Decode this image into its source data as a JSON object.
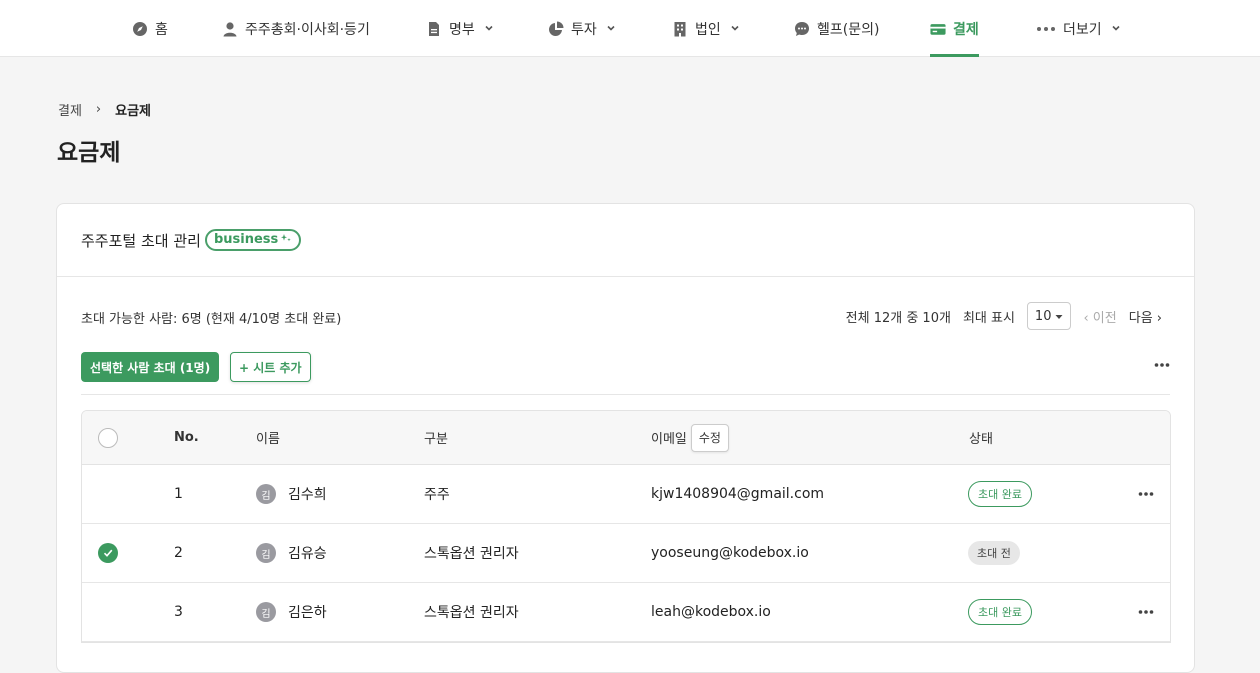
{
  "nav": {
    "items": [
      {
        "label": "홈",
        "icon": "compass-icon",
        "has_dropdown": false
      },
      {
        "label": "주주총회·이사회·등기",
        "icon": "person-icon",
        "has_dropdown": false
      },
      {
        "label": "명부",
        "icon": "document-icon",
        "has_dropdown": true
      },
      {
        "label": "투자",
        "icon": "pie-chart-icon",
        "has_dropdown": true
      },
      {
        "label": "법인",
        "icon": "building-icon",
        "has_dropdown": true
      },
      {
        "label": "헬프(문의)",
        "icon": "chat-bubble-icon",
        "has_dropdown": false
      },
      {
        "label": "결제",
        "icon": "credit-card-icon",
        "has_dropdown": false,
        "active": true
      },
      {
        "label": "더보기",
        "icon": "more-dots-icon",
        "has_dropdown": true
      }
    ]
  },
  "breadcrumb": {
    "parent": "결제",
    "separator": "›",
    "current": "요금제"
  },
  "page_title": "요금제",
  "card": {
    "title": "주주포털 초대 관리",
    "badge": "business",
    "info_text": "초대 가능한 사람: 6명 (현재 4/10명 초대 완료)",
    "pager": {
      "summary": "전체 12개 중 10개",
      "per_page_label": "최대 표시",
      "per_page_value": "10",
      "prev_label": "‹ 이전",
      "next_label": "다음 ›"
    },
    "invite_button": "선택한 사람 초대 (1명)",
    "add_seat_button": "+ 시트 추가"
  },
  "table": {
    "headers": {
      "no": "No.",
      "name": "이름",
      "category": "구분",
      "email": "이메일",
      "edit": "수정",
      "status": "상태"
    },
    "rows": [
      {
        "no": "1",
        "avatar": "김",
        "name": "김수희",
        "category": "주주",
        "email": "kjw1408904@gmail.com",
        "status": "초대 완료",
        "status_type": "done",
        "checked": false,
        "has_more": true
      },
      {
        "no": "2",
        "avatar": "김",
        "name": "김유승",
        "category": "스톡옵션 권리자",
        "email": "yooseung@kodebox.io",
        "status": "초대 전",
        "status_type": "before",
        "checked": true,
        "has_more": false
      },
      {
        "no": "3",
        "avatar": "김",
        "name": "김은하",
        "category": "스톡옵션 권리자",
        "email": "leah@kodebox.io",
        "status": "초대 완료",
        "status_type": "done",
        "checked": false,
        "has_more": true
      }
    ]
  },
  "colors": {
    "accent": "#3c9a5f",
    "background": "#f5f5f5"
  }
}
